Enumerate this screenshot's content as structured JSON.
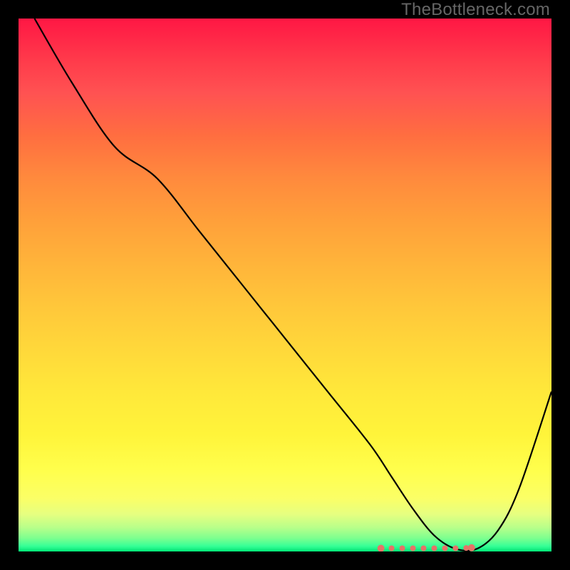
{
  "watermark": "TheBottleneck.com",
  "chart_data": {
    "type": "line",
    "title": "",
    "xlabel": "",
    "ylabel": "",
    "xlim": [
      0,
      100
    ],
    "ylim": [
      0,
      100
    ],
    "series": [
      {
        "name": "bottleneck-curve",
        "x": [
          3,
          10,
          18,
          26,
          34,
          42,
          50,
          58,
          66,
          70,
          74,
          78,
          82,
          86,
          90,
          94,
          100
        ],
        "values": [
          100,
          88,
          76,
          70,
          60,
          50,
          40,
          30,
          20,
          14,
          8,
          3,
          0.5,
          0.5,
          4,
          12,
          30
        ]
      }
    ],
    "markers": {
      "name": "highlight-cluster",
      "x": [
        68,
        70,
        72,
        74,
        76,
        78,
        80,
        82,
        84,
        85
      ],
      "values": [
        0.6,
        0.6,
        0.6,
        0.6,
        0.6,
        0.6,
        0.6,
        0.6,
        0.65,
        0.7
      ],
      "color": "#e57368"
    }
  }
}
